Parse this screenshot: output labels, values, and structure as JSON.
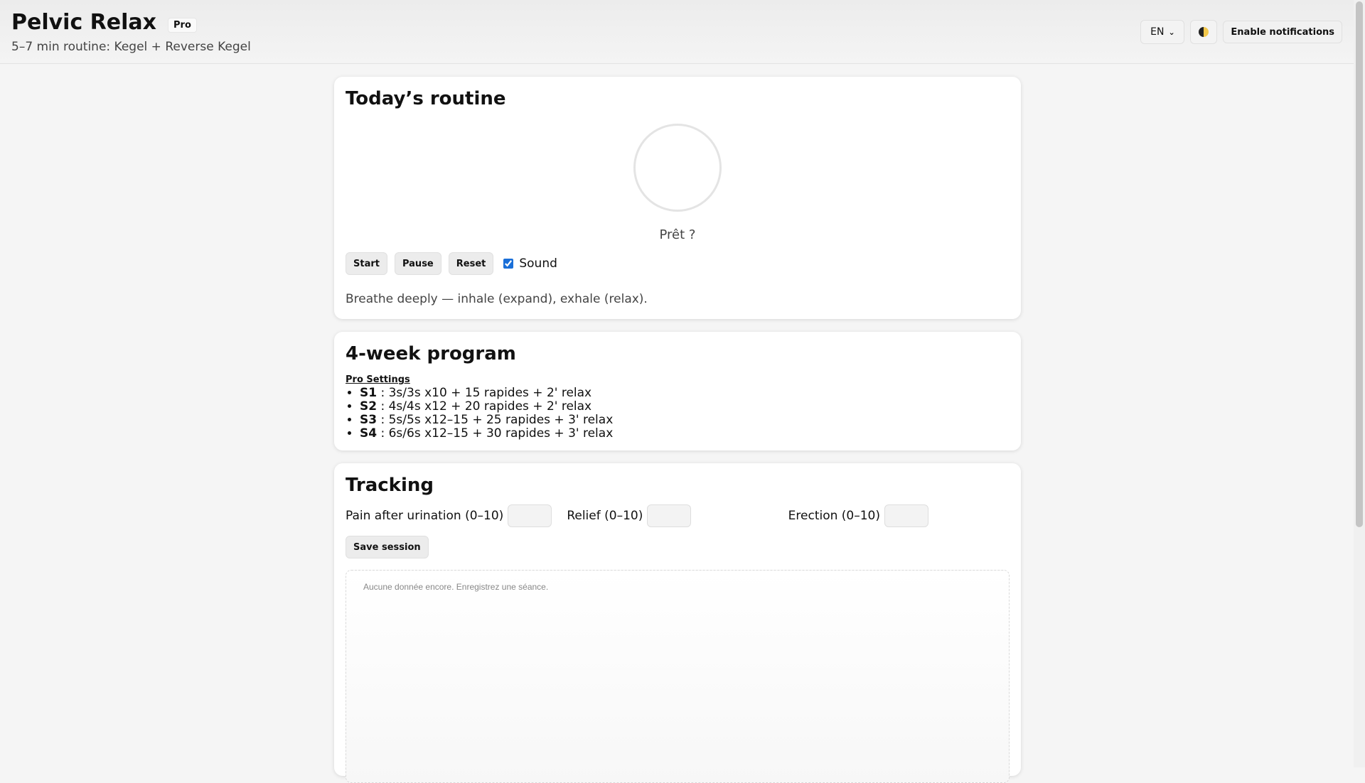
{
  "header": {
    "title": "Pelvic Relax",
    "badge": "Pro",
    "subtitle": "5–7 min routine: Kegel + Reverse Kegel",
    "language": "EN",
    "notify_label": "Enable notifications"
  },
  "routine": {
    "title": "Today’s routine",
    "status": "Prêt ?",
    "start_label": "Start",
    "pause_label": "Pause",
    "reset_label": "Reset",
    "sound_label": "Sound",
    "sound_checked": true,
    "hint": "Breathe deeply — inhale (expand), exhale (relax)."
  },
  "program": {
    "title": "4-week program",
    "settings_link": "Pro Settings",
    "weeks": [
      {
        "label": "S1",
        "text": " : 3s/3s x10 + 15 rapides + 2' relax"
      },
      {
        "label": "S2",
        "text": " : 4s/4s x12 + 20 rapides + 2' relax"
      },
      {
        "label": "S3",
        "text": " : 5s/5s x12–15 + 25 rapides + 3' relax"
      },
      {
        "label": "S4",
        "text": " : 6s/6s x12–15 + 30 rapides + 3' relax"
      }
    ]
  },
  "tracking": {
    "title": "Tracking",
    "pain_label": "Pain after urination (0–10)",
    "relief_label": "Relief (0–10)",
    "erection_label": "Erection (0–10)",
    "save_label": "Save session",
    "empty_message": "Aucune donnée encore. Enregistrez une séance."
  },
  "colors": {
    "accent": "#1a6fd8",
    "background": "#f5f5f5"
  },
  "icons": {
    "theme": "half-moon-icon",
    "dropdown": "chevron-down-icon"
  }
}
